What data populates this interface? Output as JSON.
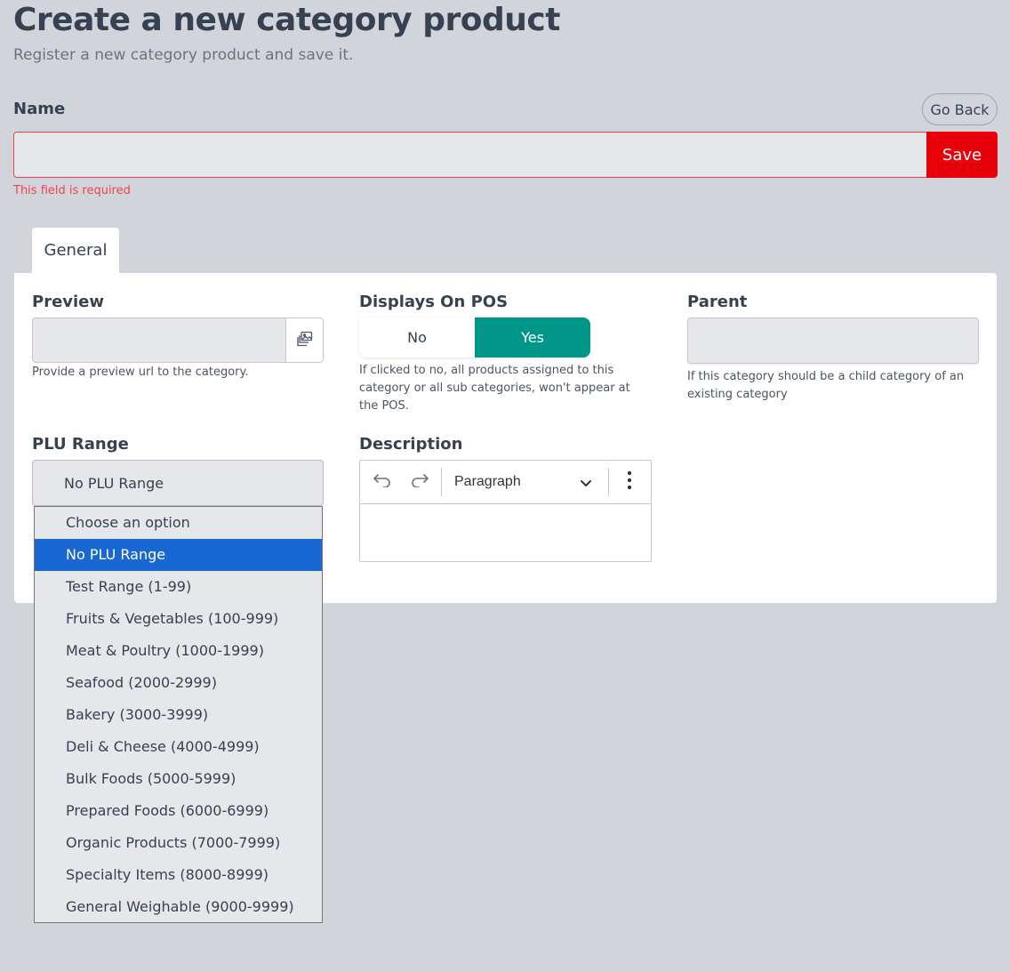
{
  "header": {
    "title": "Create a new category product",
    "subtitle": "Register a new category product and save it."
  },
  "name_field": {
    "label": "Name",
    "value": "",
    "go_back_label": "Go Back",
    "save_label": "Save",
    "error": "This field is required"
  },
  "tabs": [
    {
      "label": "General",
      "active": true
    }
  ],
  "fields": {
    "preview": {
      "label": "Preview",
      "value": "",
      "help": "Provide a preview url to the category.",
      "icon": "image-picker-icon"
    },
    "displays_on_pos": {
      "label": "Displays On POS",
      "options": [
        "No",
        "Yes"
      ],
      "selected": "Yes",
      "help": "If clicked to no, all products assigned to this category or all sub categories, won't appear at the POS."
    },
    "parent": {
      "label": "Parent",
      "value": "",
      "help": "If this category should be a child category of an existing category"
    },
    "plu_range": {
      "label": "PLU Range",
      "selected": "No PLU Range",
      "options": [
        "Choose an option",
        "No PLU Range",
        "Test Range (1-99)",
        "Fruits & Vegetables (100-999)",
        "Meat & Poultry (1000-1999)",
        "Seafood (2000-2999)",
        "Bakery (3000-3999)",
        "Deli & Cheese (4000-4999)",
        "Bulk Foods (5000-5999)",
        "Prepared Foods (6000-6999)",
        "Organic Products (7000-7999)",
        "Specialty Items (8000-8999)",
        "General Weighable (9000-9999)"
      ]
    },
    "description": {
      "label": "Description",
      "format": "Paragraph",
      "value": ""
    }
  },
  "colors": {
    "background": "#d1d5db",
    "error": "#ef4444",
    "save": "#e8000b",
    "toggle_active": "#009688",
    "option_selected": "#1967d2"
  }
}
